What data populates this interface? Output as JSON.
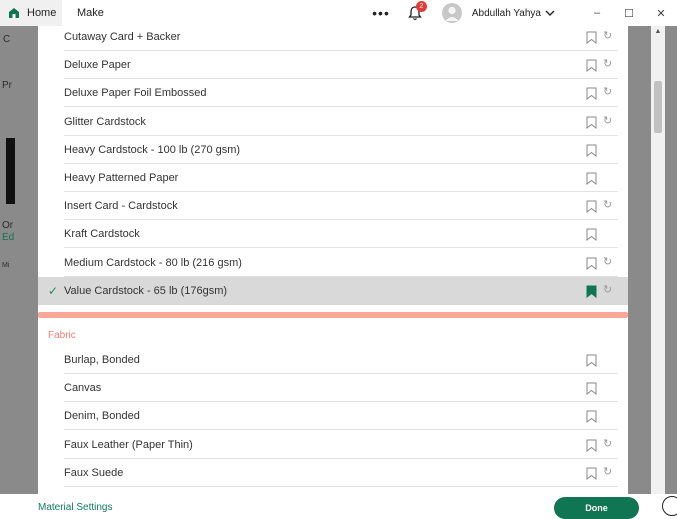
{
  "titlebar": {
    "home_tab": "Home",
    "make_tab": "Make",
    "more": "•••",
    "notification_count": "2",
    "user_name": "Abdullah Yahya",
    "minimize": "–",
    "maximize": "☐",
    "close": "✕"
  },
  "background": {
    "pr": "Pr",
    "or": "Or",
    "ed": "Ed",
    "mi": "Mi"
  },
  "materials": {
    "cardstock": [
      {
        "label": "Cutaway Card + Backer",
        "saved": false,
        "refresh": true
      },
      {
        "label": "Deluxe Paper",
        "saved": false,
        "refresh": true
      },
      {
        "label": "Deluxe Paper Foil Embossed",
        "saved": false,
        "refresh": true
      },
      {
        "label": "Glitter Cardstock",
        "saved": false,
        "refresh": true
      },
      {
        "label": "Heavy Cardstock - 100 lb (270 gsm)",
        "saved": false,
        "refresh": false
      },
      {
        "label": "Heavy Patterned Paper",
        "saved": false,
        "refresh": false
      },
      {
        "label": "Insert Card - Cardstock",
        "saved": false,
        "refresh": true
      },
      {
        "label": "Kraft Cardstock",
        "saved": false,
        "refresh": false
      },
      {
        "label": "Medium Cardstock - 80 lb (216 gsm)",
        "saved": false,
        "refresh": true
      },
      {
        "label": "Value Cardstock - 65 lb (176gsm)",
        "saved": true,
        "refresh": true,
        "selected": true
      }
    ],
    "fabric_section_title": "Fabric",
    "fabric": [
      {
        "label": "Burlap, Bonded",
        "saved": false,
        "refresh": false
      },
      {
        "label": "Canvas",
        "saved": false,
        "refresh": false
      },
      {
        "label": "Denim, Bonded",
        "saved": false,
        "refresh": false
      },
      {
        "label": "Faux Leather (Paper Thin)",
        "saved": false,
        "refresh": true
      },
      {
        "label": "Faux Suede",
        "saved": false,
        "refresh": true
      }
    ]
  },
  "footer": {
    "material_settings": "Material Settings",
    "done": "Done"
  },
  "colors": {
    "accent": "#0f7553",
    "section_title": "#ef7f72",
    "divider_salmon": "#f8a799",
    "selected_row": "#d9d9d9"
  }
}
